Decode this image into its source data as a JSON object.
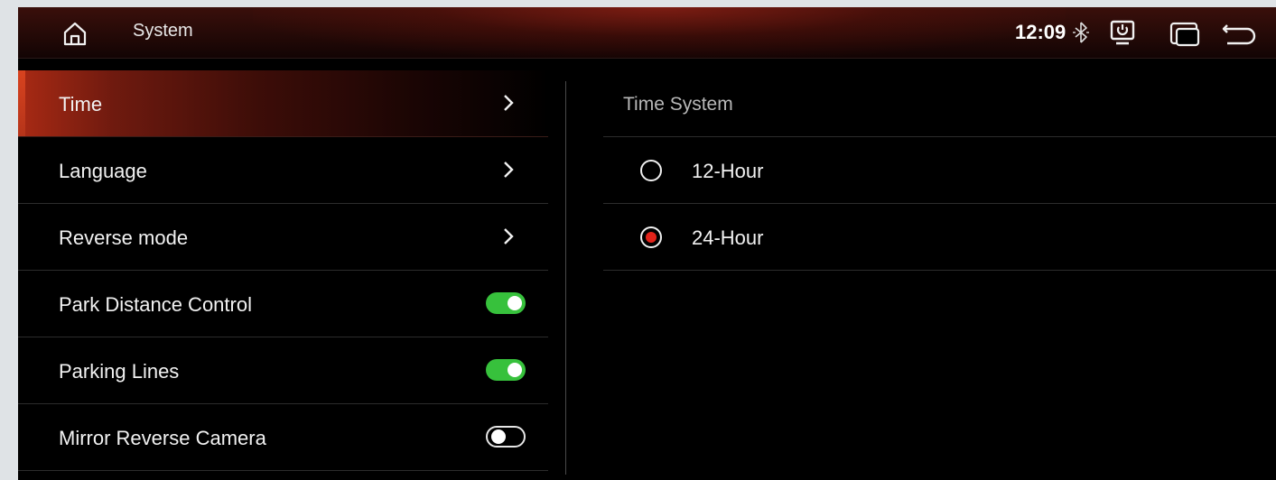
{
  "header": {
    "title": "System",
    "clock": "12:09",
    "icons": [
      "home-icon",
      "bluetooth-icon",
      "usb-power-icon",
      "windows-icon",
      "back-icon"
    ]
  },
  "menu": {
    "items": [
      {
        "label": "Time",
        "control": "chevron",
        "active": true
      },
      {
        "label": "Language",
        "control": "chevron"
      },
      {
        "label": "Reverse mode",
        "control": "chevron"
      },
      {
        "label": "Park Distance Control",
        "control": "toggle",
        "on": true
      },
      {
        "label": "Parking Lines",
        "control": "toggle",
        "on": true
      },
      {
        "label": "Mirror Reverse Camera",
        "control": "toggle",
        "on": false
      }
    ]
  },
  "panel": {
    "section_title": "Time System",
    "options": [
      {
        "label": "12-Hour",
        "selected": false
      },
      {
        "label": "24-Hour",
        "selected": true
      }
    ]
  },
  "colors": {
    "accent_red": "#e2231a",
    "toggle_on": "#37c13c",
    "active_row": "#a92a14"
  }
}
